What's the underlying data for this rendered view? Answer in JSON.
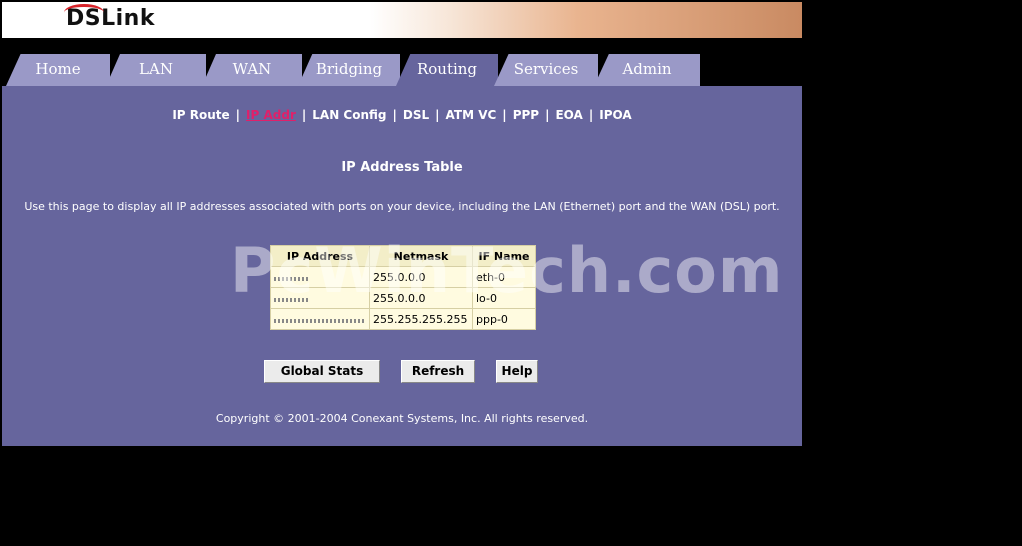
{
  "brand": {
    "logo_text": "DSLink"
  },
  "tabs": [
    {
      "label": "Home"
    },
    {
      "label": "LAN"
    },
    {
      "label": "WAN"
    },
    {
      "label": "Bridging"
    },
    {
      "label": "Routing",
      "active": true
    },
    {
      "label": "Services"
    },
    {
      "label": "Admin"
    }
  ],
  "subnav": [
    {
      "label": "IP Route"
    },
    {
      "label": "IP Addr",
      "active": true
    },
    {
      "label": "LAN Config"
    },
    {
      "label": "DSL"
    },
    {
      "label": "ATM VC"
    },
    {
      "label": "PPP"
    },
    {
      "label": "EOA"
    },
    {
      "label": "IPOA"
    }
  ],
  "page": {
    "title": "IP Address Table",
    "description": "Use this page to display all IP addresses associated with ports on your device, including the LAN (Ethernet) port and the WAN (DSL) port."
  },
  "table": {
    "headers": [
      "IP Address",
      "Netmask",
      "IF Name"
    ],
    "rows": [
      {
        "ip": "",
        "netmask": "255.0.0.0",
        "ifname": "eth-0"
      },
      {
        "ip": "",
        "netmask": "255.0.0.0",
        "ifname": "lo-0"
      },
      {
        "ip": "",
        "netmask": "255.255.255.255",
        "ifname": "ppp-0"
      }
    ]
  },
  "buttons": {
    "global_stats": "Global Stats",
    "refresh": "Refresh",
    "help": "Help"
  },
  "watermark": "PcWinTech.com",
  "footer": {
    "copyright": "Copyright © 2001-2004 Conexant Systems, Inc. All rights reserved."
  },
  "colors": {
    "panel": "#66659d",
    "tab": "#9a99c7",
    "active_link": "#e0206a",
    "table_bg": "#fffbe0"
  }
}
